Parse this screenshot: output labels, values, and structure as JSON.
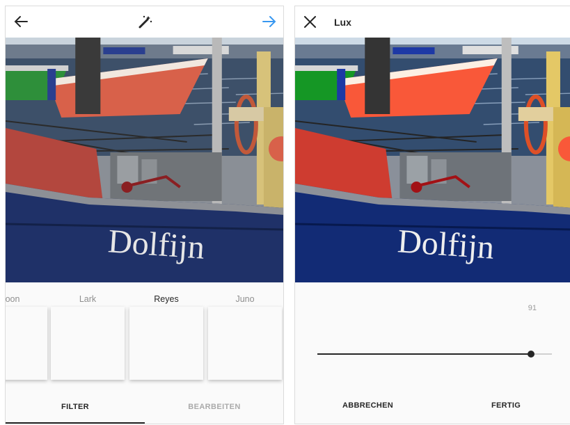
{
  "filter_screen": {
    "back_icon": "arrow-left-icon",
    "magic_icon": "magic-wand-icon",
    "next_icon": "arrow-right-icon",
    "accent_color": "#3897f0",
    "photo_text": "Dolfijn",
    "filters": [
      {
        "label": "oon",
        "selected": false
      },
      {
        "label": "Lark",
        "selected": false
      },
      {
        "label": "Reyes",
        "selected": true
      },
      {
        "label": "Juno",
        "selected": false
      }
    ],
    "tabs": {
      "filter": "FILTER",
      "edit": "BEARBEITEN"
    }
  },
  "lux_screen": {
    "close_icon": "close-icon",
    "title": "Lux",
    "photo_text": "Dolfijn",
    "value": "91",
    "slider_fraction": 0.91,
    "cancel_label": "ABBRECHEN",
    "done_label": "FERTIG"
  }
}
